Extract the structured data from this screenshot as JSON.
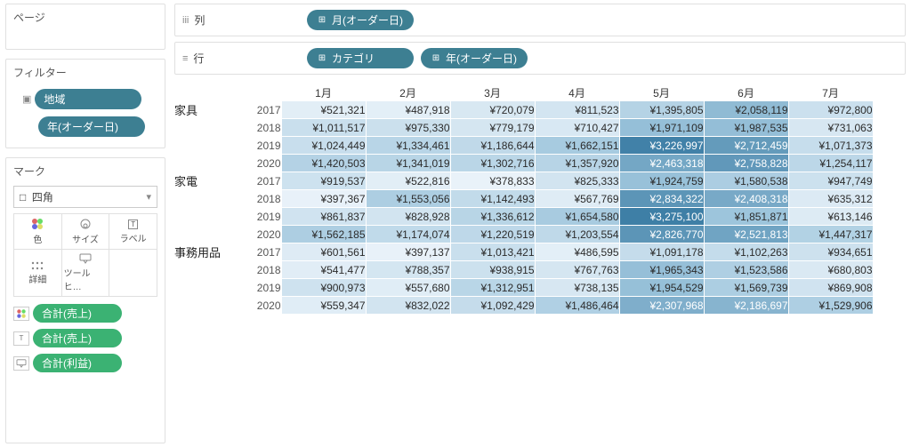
{
  "sidebar": {
    "pages_title": "ページ",
    "filters_title": "フィルター",
    "filters": [
      {
        "label": "地域"
      },
      {
        "label": "年(オーダー日)"
      }
    ],
    "marks_title": "マーク",
    "marks_type": "四角",
    "marks_type_icon": "□",
    "marks_cells": [
      {
        "label": "色"
      },
      {
        "label": "サイズ"
      },
      {
        "label": "ラベル"
      },
      {
        "label": "詳細"
      },
      {
        "label": "ツールヒ…"
      }
    ],
    "marks_items": [
      {
        "label": "合計(売上)",
        "color": "green",
        "badge": "color"
      },
      {
        "label": "合計(売上)",
        "color": "green",
        "badge": "label"
      },
      {
        "label": "合計(利益)",
        "color": "green",
        "badge": "tooltip"
      }
    ]
  },
  "shelves": {
    "columns_label": "列",
    "rows_label": "行",
    "columns": [
      {
        "label": "月(オーダー日)"
      }
    ],
    "rows": [
      {
        "label": "カテゴリ"
      },
      {
        "label": "年(オーダー日)"
      }
    ]
  },
  "chart_data": {
    "type": "heatmap",
    "columns": [
      "1月",
      "2月",
      "3月",
      "4月",
      "5月",
      "6月",
      "7月"
    ],
    "row_dims": [
      "カテゴリ",
      "年"
    ],
    "currency_prefix": "¥",
    "color_scale": {
      "min_color": "#e9f2f9",
      "mid_color": "#9fc6dd",
      "max_color": "#3e7fa6"
    },
    "categories": [
      {
        "name": "家具",
        "years": [
          {
            "year": "2017",
            "values": [
              521321,
              487918,
              720079,
              811523,
              1395805,
              2058119,
              972800
            ]
          },
          {
            "year": "2018",
            "values": [
              1011517,
              975330,
              779179,
              710427,
              1971109,
              1987535,
              731063
            ]
          },
          {
            "year": "2019",
            "values": [
              1024449,
              1334461,
              1186644,
              1662151,
              3226997,
              2712459,
              1071373
            ]
          },
          {
            "year": "2020",
            "values": [
              1420503,
              1341019,
              1302716,
              1357920,
              2463318,
              2758828,
              1254117
            ]
          }
        ]
      },
      {
        "name": "家電",
        "years": [
          {
            "year": "2017",
            "values": [
              919537,
              522816,
              378833,
              825333,
              1924759,
              1580538,
              947749
            ]
          },
          {
            "year": "2018",
            "values": [
              397367,
              1553056,
              1142493,
              567769,
              2834322,
              2408318,
              635312
            ]
          },
          {
            "year": "2019",
            "values": [
              861837,
              828928,
              1336612,
              1654580,
              3275100,
              1851871,
              613146
            ]
          },
          {
            "year": "2020",
            "values": [
              1562185,
              1174074,
              1220519,
              1203554,
              2826770,
              2521813,
              1447317
            ]
          }
        ]
      },
      {
        "name": "事務用品",
        "years": [
          {
            "year": "2017",
            "values": [
              601561,
              397137,
              1013421,
              486595,
              1091178,
              1102263,
              934651
            ]
          },
          {
            "year": "2018",
            "values": [
              541477,
              788357,
              938915,
              767763,
              1965343,
              1523586,
              680803
            ]
          },
          {
            "year": "2019",
            "values": [
              900973,
              557680,
              1312951,
              738135,
              1954529,
              1569739,
              869908
            ]
          },
          {
            "year": "2020",
            "values": [
              559347,
              832022,
              1092429,
              1486464,
              2307968,
              2186697,
              1529906
            ]
          }
        ]
      }
    ]
  }
}
